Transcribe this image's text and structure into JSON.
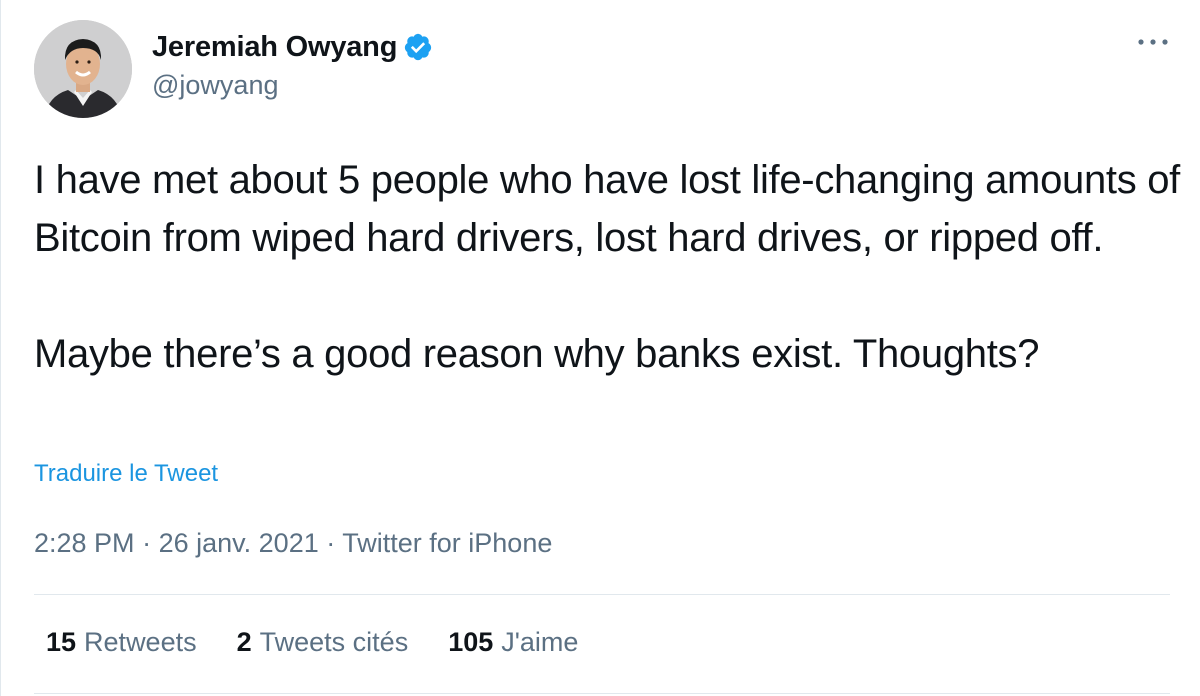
{
  "author": {
    "display_name": "Jeremiah Owyang",
    "handle": "@jowyang",
    "verified": true
  },
  "tweet": {
    "paragraphs": [
      "I have met about 5 people who have lost life-changing amounts of Bitcoin from wiped hard drivers, lost hard drives, or ripped off.",
      "Maybe there’s a good reason why banks exist. Thoughts?"
    ],
    "translate_label": "Traduire le Tweet"
  },
  "meta": {
    "time": "2:28 PM",
    "separator": "·",
    "date": "26 janv. 2021",
    "source": "Twitter for iPhone"
  },
  "stats": {
    "retweets": {
      "count": "15",
      "label": "Retweets"
    },
    "quotes": {
      "count": "2",
      "label": "Tweets cités"
    },
    "likes": {
      "count": "105",
      "label": "J'aime"
    }
  },
  "icons": {
    "verified": "verified-badge-icon",
    "more": "more-options-icon"
  },
  "colors": {
    "link": "#1b95e0",
    "secondary_text": "#5b7083",
    "verified": "#1da1f2"
  }
}
